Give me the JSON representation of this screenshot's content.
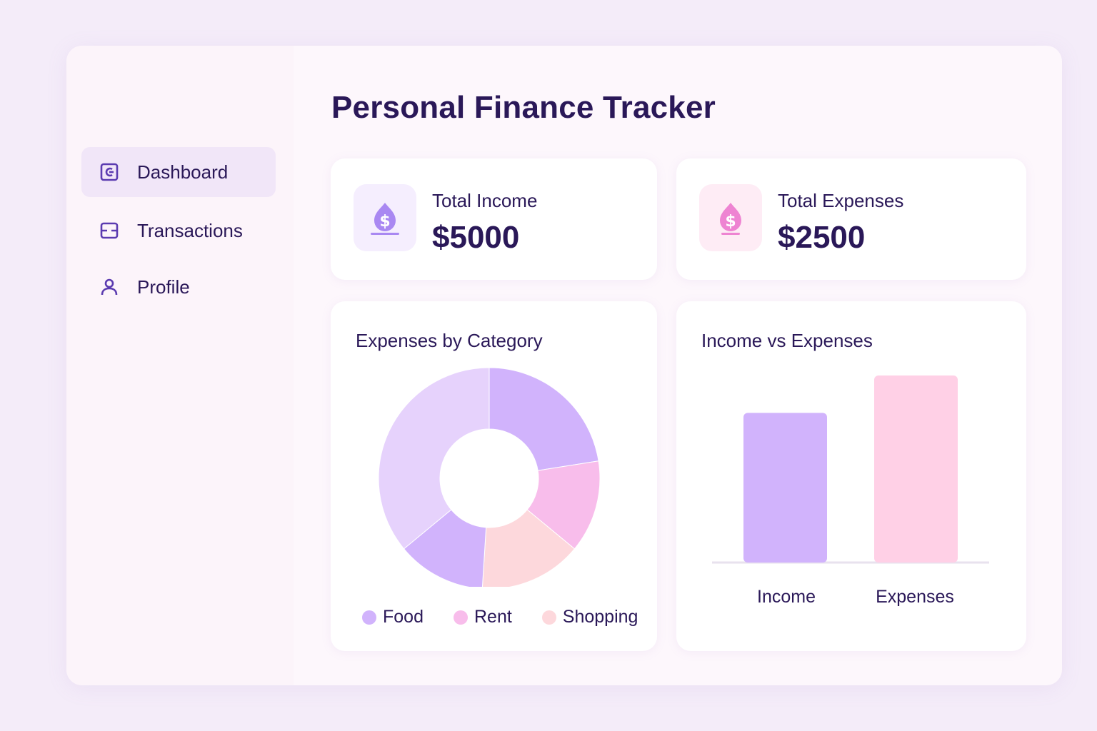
{
  "app": {
    "title": "Personal Finance Tracker"
  },
  "sidebar": {
    "items": [
      {
        "label": "Dashboard",
        "icon": "dashboard-icon",
        "active": true
      },
      {
        "label": "Transactions",
        "icon": "transactions-icon",
        "active": false
      },
      {
        "label": "Profile",
        "icon": "user-icon",
        "active": false
      }
    ]
  },
  "stats": {
    "income": {
      "label": "Total Income",
      "value": "$5000",
      "icon": "dollar-drop-icon",
      "accent": "#a27ef0"
    },
    "expenses": {
      "label": "Total Expenses",
      "value": "$2500",
      "icon": "dollar-drop-icon",
      "accent": "#ee7fd0"
    }
  },
  "colors": {
    "primary_text": "#2a1858",
    "purple": "#d1b3fc",
    "light_purple": "#e6d2fc",
    "pink": "#f8bdeb",
    "peach": "#fdd8dc",
    "bar_pink": "#ffd0e6"
  },
  "chart_data": [
    {
      "type": "pie",
      "title": "Expenses by Category",
      "slices": [
        {
          "name": "Food",
          "value": 22.5,
          "color": "#d1b3fc"
        },
        {
          "name": "Rent",
          "value": 13.5,
          "color": "#f8bdeb"
        },
        {
          "name": "Shopping",
          "value": 15,
          "color": "#fdd8dc"
        },
        {
          "name": "",
          "value": 13,
          "color": "#d1b3fc"
        },
        {
          "name": "",
          "value": 36,
          "color": "#e6d2fc"
        }
      ],
      "legend": [
        {
          "name": "Food",
          "color": "#d1b3fc"
        },
        {
          "name": "Rent",
          "color": "#f8bdeb"
        },
        {
          "name": "Shopping",
          "color": "#fdd8dc"
        }
      ],
      "legend_position": "bottom"
    },
    {
      "type": "bar",
      "title": "Income vs Expenses",
      "categories": [
        "Income",
        "Expenses"
      ],
      "values": [
        100,
        125
      ],
      "colors": [
        "#d1b3fc",
        "#ffd0e6"
      ],
      "ylim": [
        0,
        135
      ],
      "grid": false
    }
  ]
}
